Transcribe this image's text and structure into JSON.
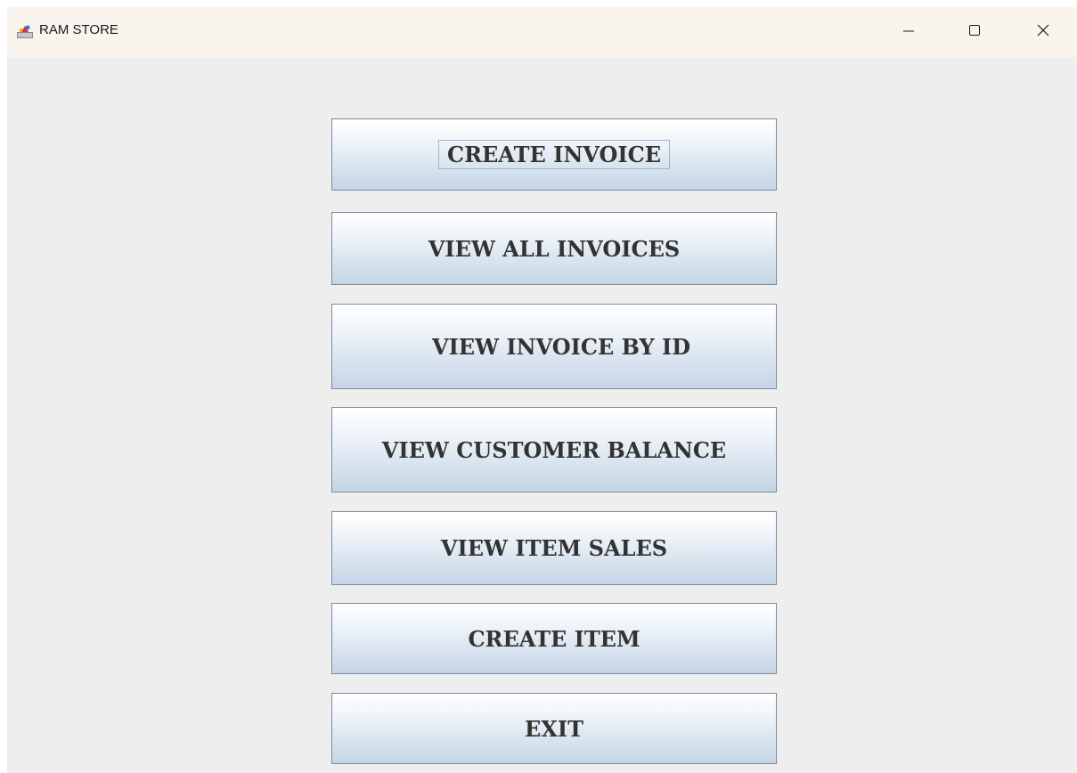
{
  "window": {
    "title": "RAM STORE",
    "app_icon": "java-app-icon",
    "controls": {
      "minimize_icon": "minimize-icon",
      "maximize_icon": "maximize-icon",
      "close_icon": "close-icon"
    }
  },
  "menu": {
    "buttons": [
      {
        "label": "CREATE INVOICE"
      },
      {
        "label": "VIEW ALL INVOICES"
      },
      {
        "label": "VIEW INVOICE BY ID"
      },
      {
        "label": "VIEW CUSTOMER BALANCE"
      },
      {
        "label": "VIEW ITEM SALES"
      },
      {
        "label": "CREATE ITEM"
      },
      {
        "label": "EXIT"
      }
    ],
    "focused_index": 0
  },
  "colors": {
    "window_background": "#eeeeee",
    "titlebar_background": "#faf4ef",
    "button_text": "#333333",
    "button_border": "#7a8aa0"
  }
}
